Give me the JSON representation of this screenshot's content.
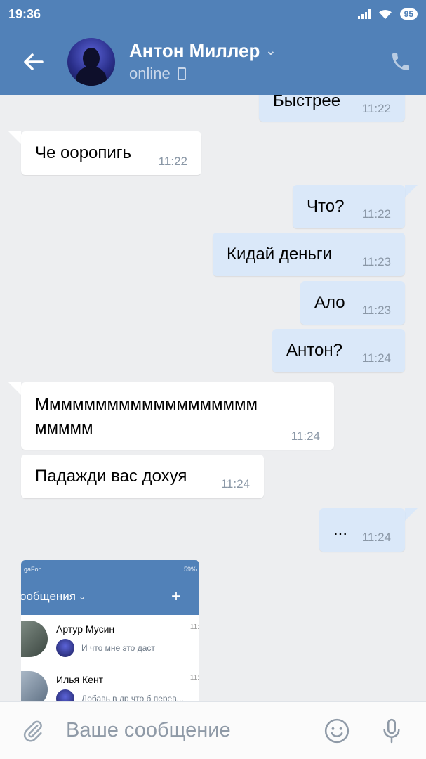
{
  "status_bar": {
    "time": "19:36",
    "battery": "95"
  },
  "header": {
    "name": "Антон Миллер",
    "status": "online"
  },
  "messages": [
    {
      "dir": "out",
      "text": "Быстрее",
      "time": "11:22"
    },
    {
      "dir": "in",
      "text": "Че ооропигь",
      "time": "11:22"
    },
    {
      "dir": "out",
      "text": "Что?",
      "time": "11:22"
    },
    {
      "dir": "out",
      "text": "Кидай деньги",
      "time": "11:23"
    },
    {
      "dir": "out",
      "text": "Ало",
      "time": "11:23"
    },
    {
      "dir": "out",
      "text": "Антон?",
      "time": "11:24"
    },
    {
      "dir": "in",
      "text_line1": "Ммммммммммммммммммм",
      "text_line2": "ммммм",
      "time": "11:24"
    },
    {
      "dir": "in",
      "text": "Падажди вас дохуя",
      "time": "11:24"
    },
    {
      "dir": "out",
      "text": "...",
      "time": "11:24"
    }
  ],
  "attachment": {
    "status_left": "gaFon",
    "status_right": "59%",
    "title": "ообщения",
    "dialogs": [
      {
        "name": "Артур Мусин",
        "preview": "И что мне это даст",
        "time": "11:"
      },
      {
        "name": "Илья Кент",
        "preview": "Добавь в др что б перев...",
        "time": "11:"
      }
    ]
  },
  "composer": {
    "placeholder": "Ваше сообщение"
  },
  "colors": {
    "header": "#5181b8",
    "outgoing_bubble": "#dae8f9",
    "incoming_bubble": "#ffffff",
    "background": "#edeef0"
  }
}
